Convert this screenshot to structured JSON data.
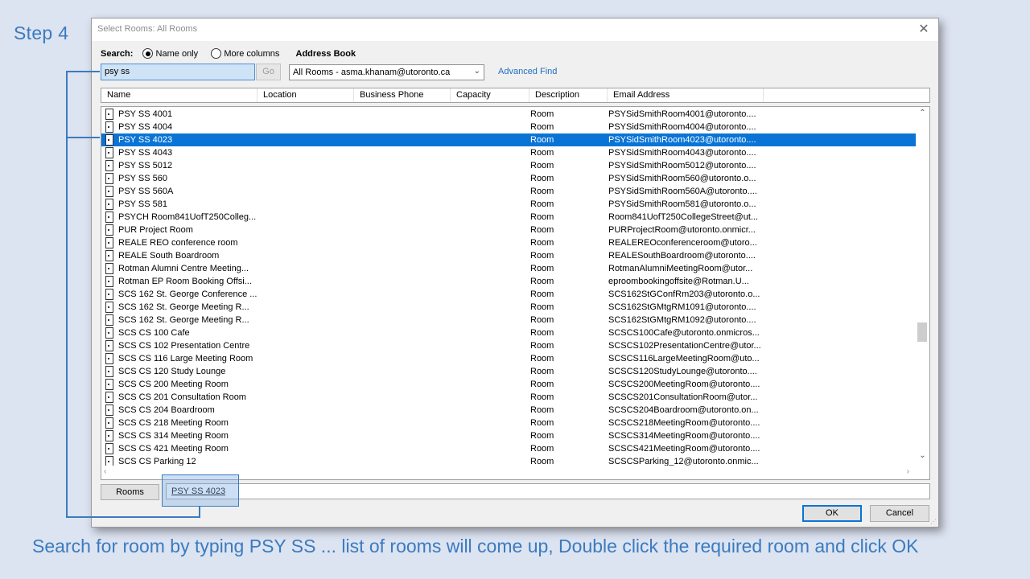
{
  "slide": {
    "step_label": "Step 4",
    "caption": "Search for room by typing PSY SS ... list of rooms will come up, Double click the required room and click OK"
  },
  "dialog": {
    "title": "Select Rooms: All Rooms",
    "search_label": "Search:",
    "radio_name_only": "Name only",
    "radio_more_columns": "More columns",
    "address_book_label": "Address Book",
    "search_value": "psy ss",
    "go_label": "Go",
    "address_book_value": "All Rooms - asma.khanam@utoronto.ca",
    "advanced_find": "Advanced Find",
    "columns": [
      "Name",
      "Location",
      "Business Phone",
      "Capacity",
      "Description",
      "Email Address"
    ],
    "rows": [
      {
        "name": "PSY SS 4001",
        "description": "Room",
        "email": "PSYSidSmithRoom4001@utoronto...."
      },
      {
        "name": "PSY SS 4004",
        "description": "Room",
        "email": "PSYSidSmithRoom4004@utoronto...."
      },
      {
        "name": "PSY SS 4023",
        "description": "Room",
        "email": "PSYSidSmithRoom4023@utoronto...."
      },
      {
        "name": "PSY SS 4043",
        "description": "Room",
        "email": "PSYSidSmithRoom4043@utoronto...."
      },
      {
        "name": "PSY SS 5012",
        "description": "Room",
        "email": "PSYSidSmithRoom5012@utoronto...."
      },
      {
        "name": "PSY SS 560",
        "description": "Room",
        "email": "PSYSidSmithRoom560@utoronto.o..."
      },
      {
        "name": "PSY SS 560A",
        "description": "Room",
        "email": "PSYSidSmithRoom560A@utoronto...."
      },
      {
        "name": "PSY SS 581",
        "description": "Room",
        "email": "PSYSidSmithRoom581@utoronto.o..."
      },
      {
        "name": "PSYCH Room841UofT250Colleg...",
        "description": "Room",
        "email": "Room841UofT250CollegeStreet@ut..."
      },
      {
        "name": "PUR Project Room",
        "description": "Room",
        "email": "PURProjectRoom@utoronto.onmicr..."
      },
      {
        "name": "REALE REO conference room",
        "description": "Room",
        "email": "REALEREOconferenceroom@utoro..."
      },
      {
        "name": "REALE South Boardroom",
        "description": "Room",
        "email": "REALESouthBoardroom@utoronto...."
      },
      {
        "name": "Rotman Alumni Centre Meeting...",
        "description": "Room",
        "email": "RotmanAlumniMeetingRoom@utor..."
      },
      {
        "name": "Rotman EP Room Booking Offsi...",
        "description": "Room",
        "email": "eproombookingoffsite@Rotman.U..."
      },
      {
        "name": "SCS 162 St. George Conference ...",
        "description": "Room",
        "email": "SCS162StGConfRm203@utoronto.o..."
      },
      {
        "name": "SCS 162 St. George Meeting R...",
        "description": "Room",
        "email": "SCS162StGMtgRM1091@utoronto...."
      },
      {
        "name": "SCS 162 St. George Meeting R...",
        "description": "Room",
        "email": "SCS162StGMtgRM1092@utoronto...."
      },
      {
        "name": "SCS CS 100 Cafe",
        "description": "Room",
        "email": "SCSCS100Cafe@utoronto.onmicros..."
      },
      {
        "name": "SCS CS 102 Presentation Centre",
        "description": "Room",
        "email": "SCSCS102PresentationCentre@utor..."
      },
      {
        "name": "SCS CS 116 Large Meeting Room",
        "description": "Room",
        "email": "SCSCS116LargeMeetingRoom@uto..."
      },
      {
        "name": "SCS CS 120 Study Lounge",
        "description": "Room",
        "email": "SCSCS120StudyLounge@utoronto...."
      },
      {
        "name": "SCS CS 200 Meeting Room",
        "description": "Room",
        "email": "SCSCS200MeetingRoom@utoronto...."
      },
      {
        "name": "SCS CS 201 Consultation Room",
        "description": "Room",
        "email": "SCSCS201ConsultationRoom@utor..."
      },
      {
        "name": "SCS CS 204 Boardroom",
        "description": "Room",
        "email": "SCSCS204Boardroom@utoronto.on..."
      },
      {
        "name": "SCS CS 218 Meeting Room",
        "description": "Room",
        "email": "SCSCS218MeetingRoom@utoronto...."
      },
      {
        "name": "SCS CS 314 Meeting Room",
        "description": "Room",
        "email": "SCSCS314MeetingRoom@utoronto...."
      },
      {
        "name": "SCS CS 421 Meeting Room",
        "description": "Room",
        "email": "SCSCS421MeetingRoom@utoronto...."
      },
      {
        "name": "SCS CS Parking 12",
        "description": "Room",
        "email": "SCSCSParking_12@utoronto.onmic..."
      }
    ],
    "selected_index": 2,
    "rooms_button": "Rooms",
    "rooms_value": "PSY SS 4023",
    "ok_label": "OK",
    "cancel_label": "Cancel"
  },
  "colors": {
    "accent": "#3b7bbf",
    "selection": "#0a74d6",
    "link": "#1f6ec2"
  }
}
